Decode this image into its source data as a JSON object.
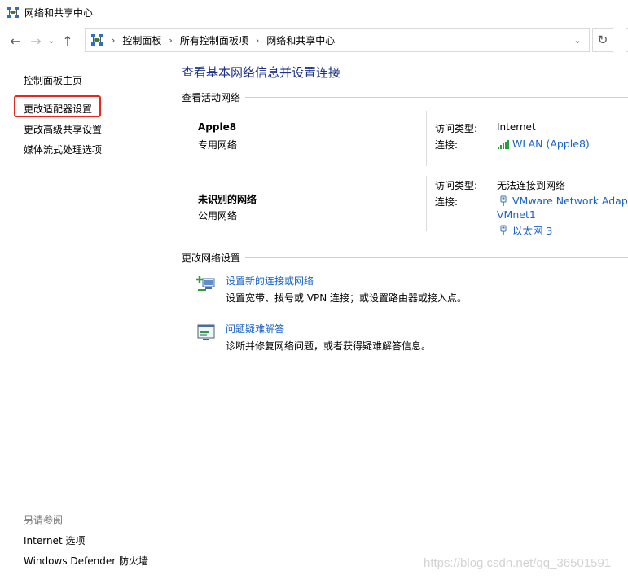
{
  "window": {
    "title": "网络和共享中心"
  },
  "nav": {
    "back_glyph": "←",
    "forward_glyph": "→",
    "recent_glyph": "⌄",
    "up_glyph": "↑",
    "breadcrumbs": [
      "控制面板",
      "所有控制面板项",
      "网络和共享中心"
    ],
    "separator": "›",
    "dropdown_glyph": "⌄",
    "refresh_glyph": "↻"
  },
  "sidebar": {
    "home": "控制面板主页",
    "items": [
      "更改适配器设置",
      "更改高级共享设置",
      "媒体流式处理选项"
    ],
    "see_also_label": "另请参阅",
    "see_also": [
      "Internet 选项",
      "Windows Defender 防火墙"
    ],
    "highlight_color": "#e8261e"
  },
  "main": {
    "title": "查看基本网络信息并设置连接",
    "active_section": "查看活动网络",
    "networks": [
      {
        "name": "Apple8",
        "category": "专用网络",
        "access_label": "访问类型:",
        "access_value": "Internet",
        "conn_label": "连接:",
        "connections": [
          "WLAN (Apple8)"
        ]
      },
      {
        "name": "未识别的网络",
        "category": "公用网络",
        "access_label": "访问类型:",
        "access_value": "无法连接到网络",
        "conn_label": "连接:",
        "connections": [
          "VMware Network Adapter",
          "VMnet1",
          "以太网 3"
        ]
      }
    ],
    "change_section": "更改网络设置",
    "tasks": [
      {
        "title": "设置新的连接或网络",
        "desc": "设置宽带、拨号或 VPN 连接；或设置路由器或接入点。"
      },
      {
        "title": "问题疑难解答",
        "desc": "诊断并修复网络问题，或者获得疑难解答信息。"
      }
    ]
  },
  "colors": {
    "title_blue": "#1e3287",
    "link_blue": "#1a63c6",
    "wifi_green": "#2e9e3a"
  },
  "watermark": "https://blog.csdn.net/qq_36501591"
}
